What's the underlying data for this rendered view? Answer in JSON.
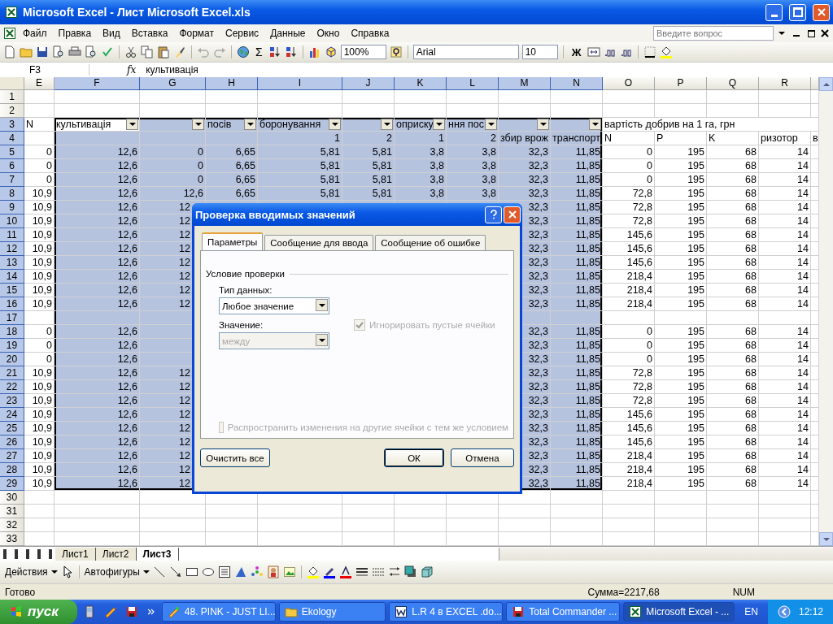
{
  "window": {
    "title": "Microsoft Excel - Лист Microsoft Excel.xls"
  },
  "menu": [
    "Файл",
    "Правка",
    "Вид",
    "Вставка",
    "Формат",
    "Сервис",
    "Данные",
    "Окно",
    "Справка"
  ],
  "help_box": {
    "placeholder": "Введите вопрос"
  },
  "toolbar": {
    "sum_symbol": "Σ",
    "zoom": "100%",
    "font": "Arial",
    "font_size": "10",
    "bold": "Ж"
  },
  "formula_bar": {
    "name_box": "F3",
    "fx": "fx",
    "value": "культивація"
  },
  "columns": [
    {
      "label": "E",
      "selected": false
    },
    {
      "label": "F",
      "selected": true
    },
    {
      "label": "G",
      "selected": true
    },
    {
      "label": "H",
      "selected": true
    },
    {
      "label": "I",
      "selected": true
    },
    {
      "label": "J",
      "selected": true
    },
    {
      "label": "K",
      "selected": true
    },
    {
      "label": "L",
      "selected": true
    },
    {
      "label": "M",
      "selected": true
    },
    {
      "label": "N",
      "selected": true
    },
    {
      "label": "O",
      "selected": false
    },
    {
      "label": "P",
      "selected": false
    },
    {
      "label": "Q",
      "selected": false
    },
    {
      "label": "R",
      "selected": false
    }
  ],
  "rows": [
    {
      "number": "1",
      "selected": false
    },
    {
      "number": "2",
      "selected": false
    },
    {
      "number": "3",
      "selected": true,
      "kind": "filter",
      "cells": [
        "N",
        "культивація",
        null,
        "посів",
        "боронування",
        null,
        "оприску",
        "ння пос",
        null,
        null,
        "вартість добрив на 1 га, грн",
        null,
        null,
        null,
        null
      ]
    },
    {
      "number": "4",
      "selected": true,
      "cells": [
        null,
        null,
        null,
        null,
        "1",
        "2",
        "1",
        "2",
        "збир врож",
        "транспорт",
        "N",
        "P",
        "K",
        "ризотор",
        "в"
      ]
    },
    {
      "number": "5",
      "selected": true,
      "cells": [
        "0",
        "12,6",
        "0",
        "6,65",
        "5,81",
        "5,81",
        "3,8",
        "3,8",
        "32,3",
        "11,85",
        "0",
        "195",
        "68",
        "14",
        null
      ]
    },
    {
      "number": "6",
      "selected": true,
      "cells": [
        "0",
        "12,6",
        "0",
        "6,65",
        "5,81",
        "5,81",
        "3,8",
        "3,8",
        "32,3",
        "11,85",
        "0",
        "195",
        "68",
        "14",
        null
      ]
    },
    {
      "number": "7",
      "selected": true,
      "cells": [
        "0",
        "12,6",
        "0",
        "6,65",
        "5,81",
        "5,81",
        "3,8",
        "3,8",
        "32,3",
        "11,85",
        "0",
        "195",
        "68",
        "14",
        null
      ]
    },
    {
      "number": "8",
      "selected": true,
      "cells": [
        "10,9",
        "12,6",
        "12,6",
        "6,65",
        "5,81",
        "5,81",
        "3,8",
        "3,8",
        "32,3",
        "11,85",
        "72,8",
        "195",
        "68",
        "14",
        null
      ]
    },
    {
      "number": "9",
      "selected": true,
      "cells": [
        "10,9",
        "12,6",
        "12",
        null,
        null,
        null,
        null,
        null,
        "32,3",
        "11,85",
        "72,8",
        "195",
        "68",
        "14",
        null
      ]
    },
    {
      "number": "10",
      "selected": true,
      "cells": [
        "10,9",
        "12,6",
        "12",
        null,
        null,
        null,
        null,
        null,
        "32,3",
        "11,85",
        "72,8",
        "195",
        "68",
        "14",
        null
      ]
    },
    {
      "number": "11",
      "selected": true,
      "cells": [
        "10,9",
        "12,6",
        "12",
        null,
        null,
        null,
        null,
        null,
        "32,3",
        "11,85",
        "145,6",
        "195",
        "68",
        "14",
        null
      ]
    },
    {
      "number": "12",
      "selected": true,
      "cells": [
        "10,9",
        "12,6",
        "12",
        null,
        null,
        null,
        null,
        null,
        "32,3",
        "11,85",
        "145,6",
        "195",
        "68",
        "14",
        null
      ]
    },
    {
      "number": "13",
      "selected": true,
      "cells": [
        "10,9",
        "12,6",
        "12",
        null,
        null,
        null,
        null,
        null,
        "32,3",
        "11,85",
        "145,6",
        "195",
        "68",
        "14",
        null
      ]
    },
    {
      "number": "14",
      "selected": true,
      "cells": [
        "10,9",
        "12,6",
        "12",
        null,
        null,
        null,
        null,
        null,
        "32,3",
        "11,85",
        "218,4",
        "195",
        "68",
        "14",
        null
      ]
    },
    {
      "number": "15",
      "selected": true,
      "cells": [
        "10,9",
        "12,6",
        "12",
        null,
        null,
        null,
        null,
        null,
        "32,3",
        "11,85",
        "218,4",
        "195",
        "68",
        "14",
        null
      ]
    },
    {
      "number": "16",
      "selected": true,
      "cells": [
        "10,9",
        "12,6",
        "12",
        null,
        null,
        null,
        null,
        null,
        "32,3",
        "11,85",
        "218,4",
        "195",
        "68",
        "14",
        null
      ]
    },
    {
      "number": "17",
      "selected": true
    },
    {
      "number": "18",
      "selected": true,
      "cells": [
        "0",
        "12,6",
        null,
        null,
        null,
        null,
        null,
        null,
        "32,3",
        "11,85",
        "0",
        "195",
        "68",
        "14",
        null
      ]
    },
    {
      "number": "19",
      "selected": true,
      "cells": [
        "0",
        "12,6",
        null,
        null,
        null,
        null,
        null,
        null,
        "32,3",
        "11,85",
        "0",
        "195",
        "68",
        "14",
        null
      ]
    },
    {
      "number": "20",
      "selected": true,
      "cells": [
        "0",
        "12,6",
        null,
        null,
        null,
        null,
        null,
        null,
        "32,3",
        "11,85",
        "0",
        "195",
        "68",
        "14",
        null
      ]
    },
    {
      "number": "21",
      "selected": true,
      "cells": [
        "10,9",
        "12,6",
        "12",
        null,
        null,
        null,
        null,
        null,
        "32,3",
        "11,85",
        "72,8",
        "195",
        "68",
        "14",
        null
      ]
    },
    {
      "number": "22",
      "selected": true,
      "cells": [
        "10,9",
        "12,6",
        "12",
        null,
        null,
        null,
        null,
        null,
        "32,3",
        "11,85",
        "72,8",
        "195",
        "68",
        "14",
        null
      ]
    },
    {
      "number": "23",
      "selected": true,
      "cells": [
        "10,9",
        "12,6",
        "12",
        null,
        null,
        null,
        null,
        null,
        "32,3",
        "11,85",
        "72,8",
        "195",
        "68",
        "14",
        null
      ]
    },
    {
      "number": "24",
      "selected": true,
      "cells": [
        "10,9",
        "12,6",
        "12",
        null,
        null,
        null,
        null,
        null,
        "32,3",
        "11,85",
        "145,6",
        "195",
        "68",
        "14",
        null
      ]
    },
    {
      "number": "25",
      "selected": true,
      "cells": [
        "10,9",
        "12,6",
        "12",
        null,
        null,
        null,
        null,
        null,
        "32,3",
        "11,85",
        "145,6",
        "195",
        "68",
        "14",
        null
      ]
    },
    {
      "number": "26",
      "selected": true,
      "cells": [
        "10,9",
        "12,6",
        "12",
        null,
        null,
        null,
        null,
        null,
        "32,3",
        "11,85",
        "145,6",
        "195",
        "68",
        "14",
        null
      ]
    },
    {
      "number": "27",
      "selected": true,
      "cells": [
        "10,9",
        "12,6",
        "12",
        null,
        null,
        null,
        null,
        null,
        "32,3",
        "11,85",
        "218,4",
        "195",
        "68",
        "14",
        null
      ]
    },
    {
      "number": "28",
      "selected": true,
      "cells": [
        "10,9",
        "12,6",
        "12",
        null,
        null,
        null,
        null,
        null,
        "32,3",
        "11,85",
        "218,4",
        "195",
        "68",
        "14",
        null
      ]
    },
    {
      "number": "29",
      "selected": true,
      "cells": [
        "10,9",
        "12,6",
        "12",
        null,
        null,
        null,
        null,
        null,
        "32,3",
        "11,85",
        "218,4",
        "195",
        "68",
        "14",
        null
      ]
    },
    {
      "number": "30",
      "selected": false
    },
    {
      "number": "31",
      "selected": false
    },
    {
      "number": "32",
      "selected": false
    },
    {
      "number": "33",
      "selected": false
    }
  ],
  "dialog": {
    "title": "Проверка вводимых значений",
    "tabs": [
      {
        "label": "Параметры",
        "selected": true
      },
      {
        "label": "Сообщение для ввода",
        "selected": false
      },
      {
        "label": "Сообщение об ошибке",
        "selected": false
      }
    ],
    "group": "Условие проверки",
    "type_label": "Тип данных:",
    "type_field": {
      "value": "Любое значение",
      "disabled": false
    },
    "ignore_blank": {
      "label": "Игнорировать пустые ячейки",
      "checked": true,
      "disabled": true
    },
    "value_label": "Значение:",
    "value_field": {
      "value": "между",
      "disabled": true
    },
    "apply_all": {
      "label": "Распространить изменения на другие ячейки с тем же условием",
      "checked": false,
      "disabled": true
    },
    "buttons": [
      {
        "label": "Очистить все",
        "default": false
      },
      {
        "label": "ОК",
        "default": true
      },
      {
        "label": "Отмена",
        "default": false
      }
    ]
  },
  "sheet_tabs": [
    {
      "label": "Лист1",
      "selected": false
    },
    {
      "label": "Лист2",
      "selected": false
    },
    {
      "label": "Лист3",
      "selected": true
    }
  ],
  "drawing_toolbar": {
    "actions": "Действия",
    "autoshapes": "Автофигуры"
  },
  "status_bar": {
    "state": "Готово",
    "sum": "Сумма=2217,68",
    "mode": "NUM"
  },
  "taskbar": {
    "start": "пуск",
    "items": [
      {
        "label": "48. PINK - JUST LI...",
        "selected": false
      },
      {
        "label": "Ekology",
        "selected": false
      },
      {
        "label": "L.R 4 в EXCEL .do...",
        "selected": false
      },
      {
        "label": "Total Commander ...",
        "selected": false
      },
      {
        "label": "Microsoft Excel - ...",
        "selected": true
      }
    ],
    "language": "EN",
    "clock": "12:12"
  }
}
